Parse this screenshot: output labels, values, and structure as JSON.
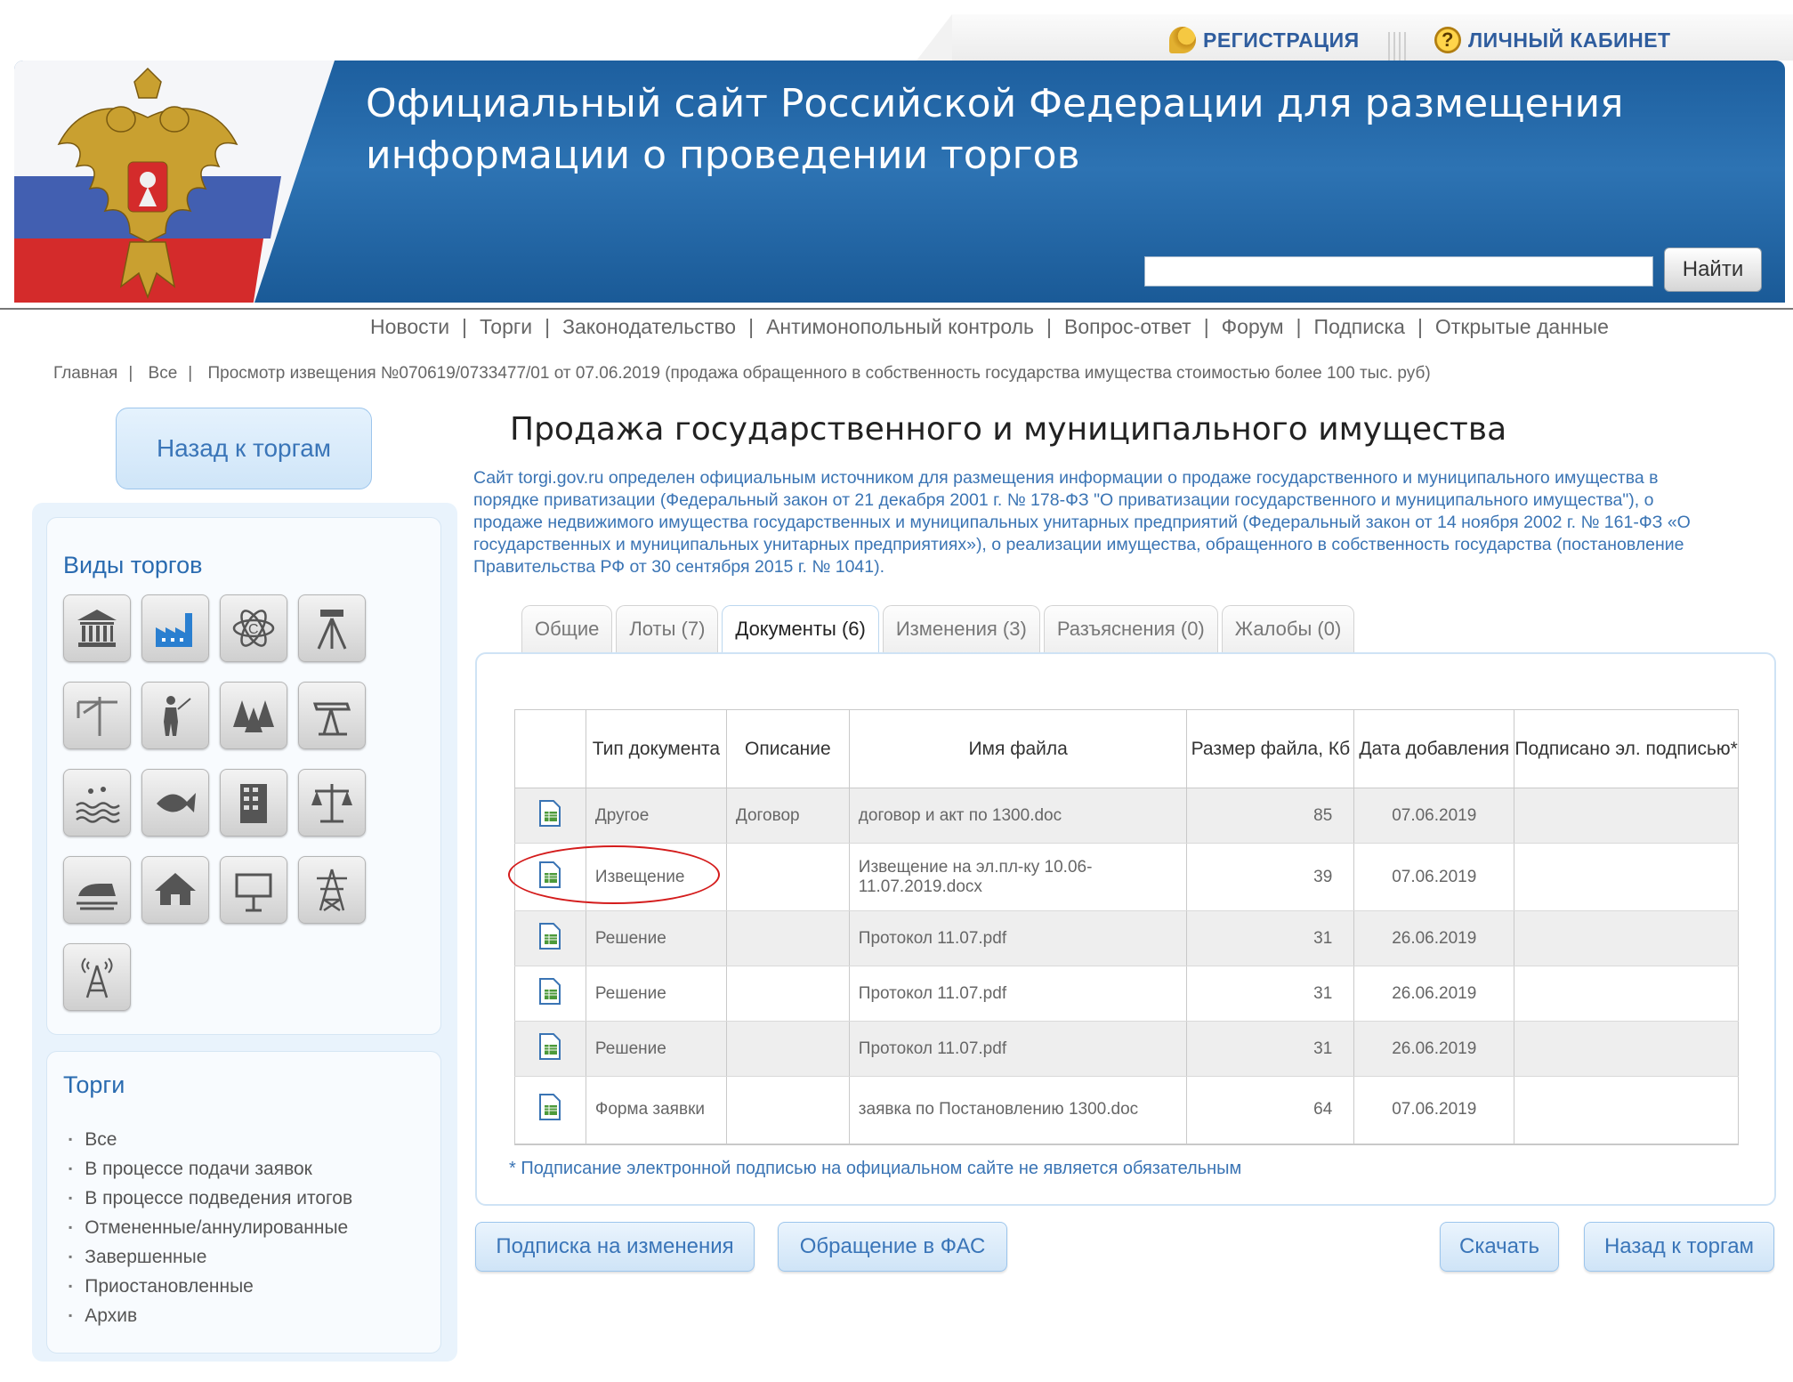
{
  "topbar": {
    "register_label": "РЕГИСТРАЦИЯ",
    "cabinet_label": "ЛИЧНЫЙ КАБИНЕТ",
    "register_icon": "key-icon",
    "cabinet_icon": "question-icon"
  },
  "header": {
    "title_line1": "Официальный сайт Российской Федерации для размещения",
    "title_line2": "информации о проведении торгов",
    "search_placeholder": "",
    "search_button": "Найти",
    "accent_color": "#1d5f9f"
  },
  "nav": {
    "items": [
      "Новости",
      "Торги",
      "Законодательство",
      "Антимонопольный контроль",
      "Вопрос-ответ",
      "Форум",
      "Подписка",
      "Открытые данные"
    ]
  },
  "breadcrumb": {
    "items": [
      "Главная",
      "Все",
      "Просмотр извещения №070619/0733477/01 от 07.06.2019 (продажа обращенного в собственность государства имущества стоимостью более 100 тыс. руб)"
    ]
  },
  "sidebar": {
    "back_button": "Назад к торгам",
    "types_title": "Виды торгов",
    "type_icons": [
      "bank-icon",
      "factory-icon",
      "atom-icon",
      "survey-tripod-icon",
      "crane-icon",
      "hunter-icon",
      "forest-icon",
      "oil-pump-icon",
      "water-icon",
      "fish-icon",
      "building-icon",
      "scales-icon",
      "railway-icon",
      "house-icon",
      "billboard-icon",
      "power-tower-icon",
      "radio-tower-icon"
    ],
    "torgi_title": "Торги",
    "statuses": [
      "Все",
      "В процессе подачи заявок",
      "В процессе подведения итогов",
      "Отмененные/аннулированные",
      "Завершенные",
      "Приостановленные",
      "Архив"
    ]
  },
  "main": {
    "title": "Продажа государственного и муниципального имущества",
    "info": "Сайт torgi.gov.ru определен официальным источником для размещения информации о продаже государственного и муниципального имущества в порядке приватизации (Федеральный закон от 21 декабря 2001 г. № 178-ФЗ \"О приватизации государственного и муниципального имущества\"), о продаже недвижимого имущества государственных и муниципальных унитарных предприятий (Федеральный закон от 14 ноября 2002 г. № 161-ФЗ «О государственных и муниципальных унитарных предприятиях»), о реализации имущества, обращенного в собственность государства (постановление Правительства РФ от 30 сентября 2015 г. № 1041).",
    "tabs": [
      "Общие",
      "Лоты (7)",
      "Документы (6)",
      "Изменения (3)",
      "Разъяснения (0)",
      "Жалобы (0)"
    ],
    "active_tab": "Документы (6)",
    "table": {
      "headers": [
        "Тип документа",
        "Описание",
        "Имя файла",
        "Размер файла, Кб",
        "Дата добавления",
        "Подписано эл. подписью*"
      ],
      "rows": [
        {
          "type": "Другое",
          "desc": "Договор",
          "file": "договор и акт по 1300.doc",
          "size": "85",
          "date": "07.06.2019",
          "signed": ""
        },
        {
          "type": "Извещение",
          "desc": "",
          "file": "Извещение на эл.пл-ку 10.06-11.07.2019.docx",
          "size": "39",
          "date": "07.06.2019",
          "signed": ""
        },
        {
          "type": "Решение",
          "desc": "",
          "file": "Протокол 11.07.pdf",
          "size": "31",
          "date": "26.06.2019",
          "signed": ""
        },
        {
          "type": "Решение",
          "desc": "",
          "file": "Протокол 11.07.pdf",
          "size": "31",
          "date": "26.06.2019",
          "signed": ""
        },
        {
          "type": "Решение",
          "desc": "",
          "file": "Протокол 11.07.pdf",
          "size": "31",
          "date": "26.06.2019",
          "signed": ""
        },
        {
          "type": "Форма заявки",
          "desc": "",
          "file": "заявка по Постановлению 1300.doc",
          "size": "64",
          "date": "07.06.2019",
          "signed": ""
        }
      ]
    },
    "footnote": "* Подписание электронной подписью на официальном сайте не является обязательным",
    "buttons": {
      "subscribe": "Подписка на изменения",
      "fas": "Обращение в ФАС",
      "download": "Скачать",
      "back": "Назад к торгам"
    }
  }
}
